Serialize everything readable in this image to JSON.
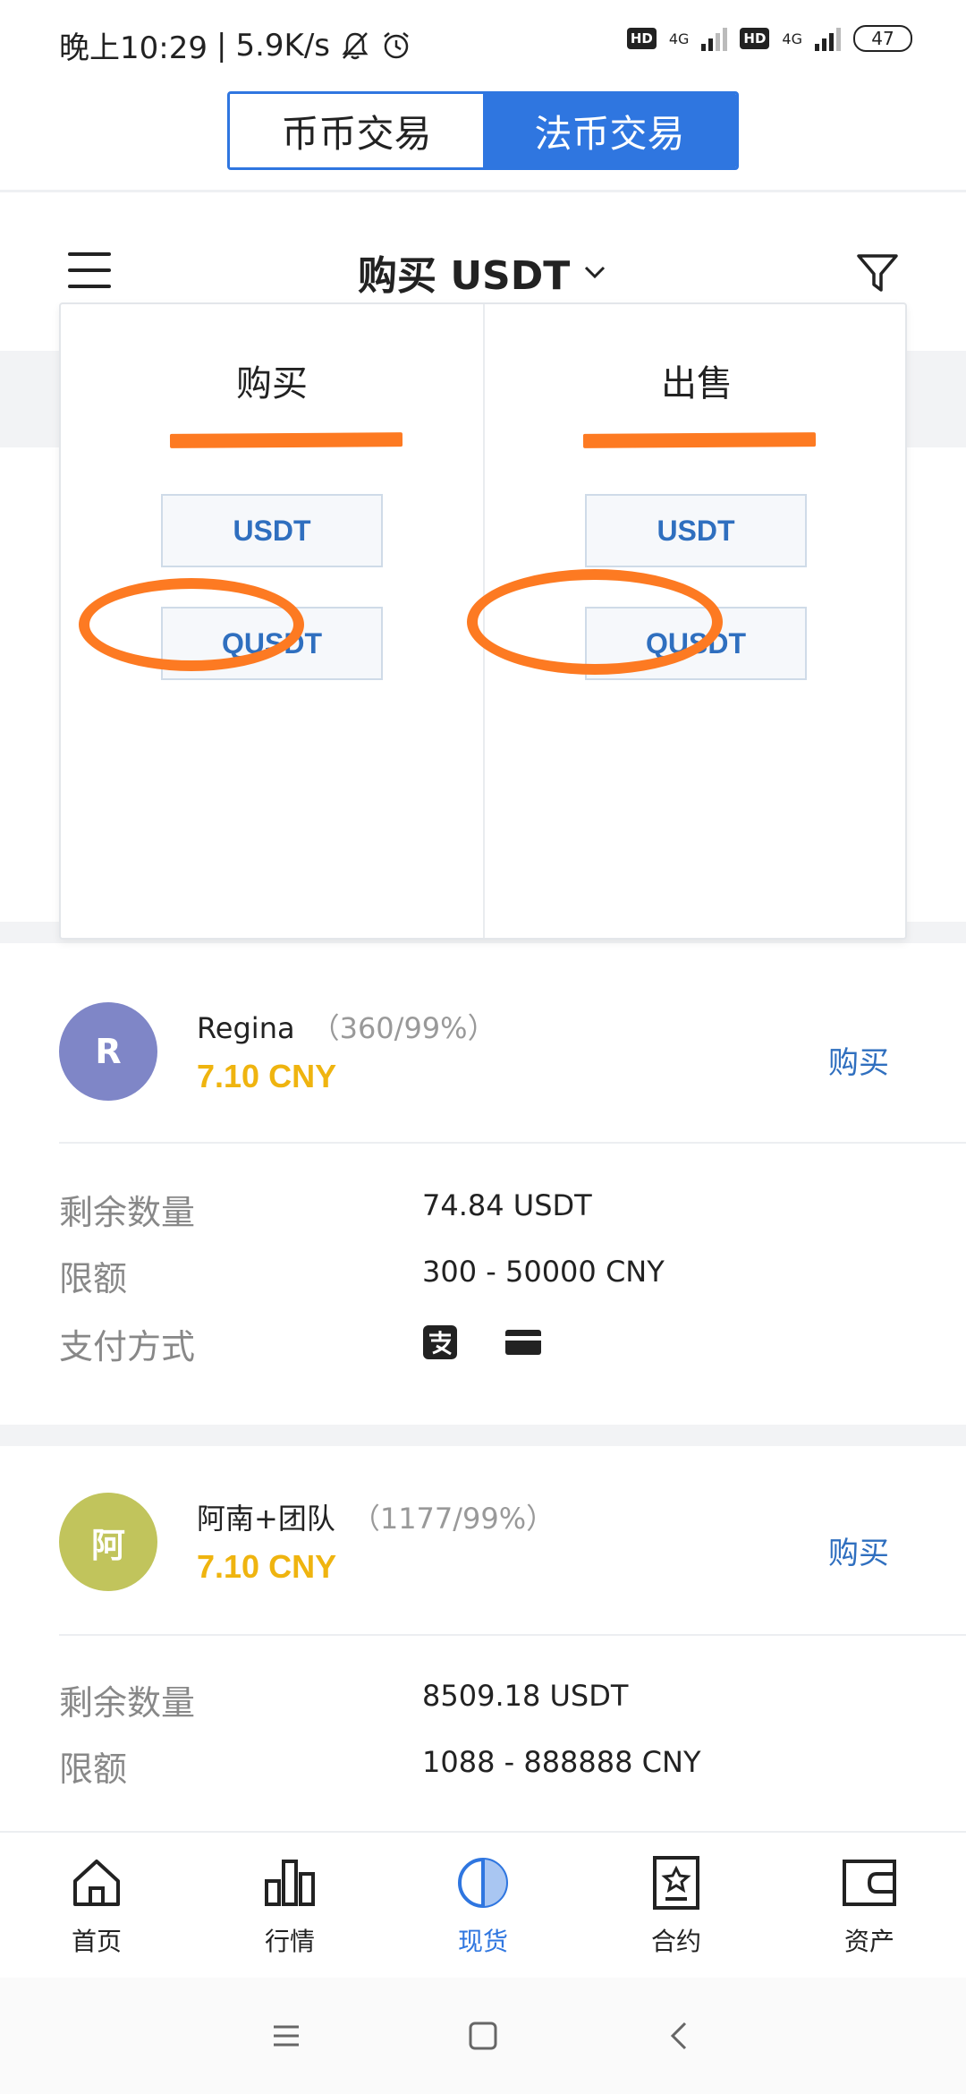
{
  "status_bar": {
    "time": "晚上10:29",
    "separator": "|",
    "speed": "5.9K/s",
    "hd1": "HD",
    "net1": "4G",
    "hd2": "HD",
    "net2": "4G",
    "battery": "47"
  },
  "top_tabs": {
    "coin_trade": "币币交易",
    "fiat_trade": "法币交易",
    "active": "法币交易"
  },
  "header": {
    "title": "购买 USDT"
  },
  "dropdown": {
    "buy": {
      "heading": "购买",
      "options": [
        "USDT",
        "QUSDT"
      ]
    },
    "sell": {
      "heading": "出售",
      "options": [
        "USDT",
        "QUSDT"
      ]
    }
  },
  "merchants": [
    {
      "avatar_letter": "R",
      "avatar_color": "#7f86c7",
      "name": "Regina",
      "stats": "（360/99%）",
      "price": "7.10 CNY",
      "action": "购买",
      "remaining_label": "剩余数量",
      "remaining_value": "74.84 USDT",
      "limit_label": "限额",
      "limit_value": "300 - 50000 CNY",
      "payment_label": "支付方式",
      "payment_icons": [
        "alipay-icon",
        "bank-card-icon"
      ]
    },
    {
      "avatar_letter": "阿",
      "avatar_color": "#c1c45c",
      "name": "阿南+团队",
      "stats": "（1177/99%）",
      "price": "7.10 CNY",
      "action": "购买",
      "remaining_label": "剩余数量",
      "remaining_value": "8509.18 USDT",
      "limit_label": "限额",
      "limit_value": "1088 - 888888 CNY"
    }
  ],
  "bottom_nav": [
    {
      "label": "首页",
      "icon": "home-icon"
    },
    {
      "label": "行情",
      "icon": "market-chart-icon"
    },
    {
      "label": "现货",
      "icon": "spot-icon",
      "active": true
    },
    {
      "label": "合约",
      "icon": "contract-icon"
    },
    {
      "label": "资产",
      "icon": "wallet-icon"
    }
  ],
  "colors": {
    "accent": "#2f76e0",
    "price": "#efb40f",
    "annotation": "#fd7a22"
  }
}
